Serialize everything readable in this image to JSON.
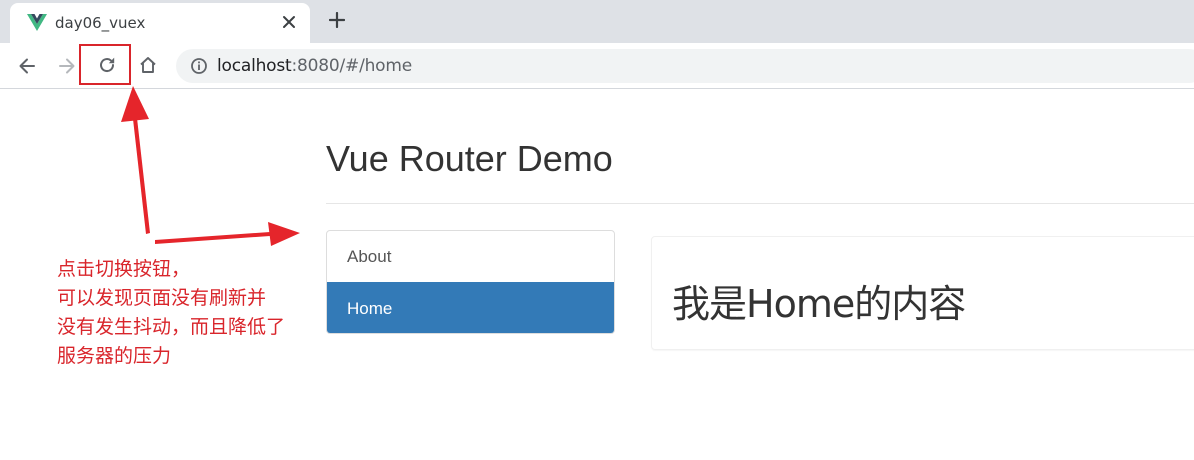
{
  "browser": {
    "tab_title": "day06_vuex",
    "url_host": "localhost",
    "url_rest": ":8080/#/home",
    "favicon": "vue-logo",
    "icons": [
      "back-icon",
      "forward-icon",
      "reload-icon",
      "home-icon",
      "info-icon",
      "close-icon",
      "plus-icon"
    ]
  },
  "page": {
    "title": "Vue Router Demo",
    "nav": [
      {
        "label": "About",
        "active": false
      },
      {
        "label": "Home",
        "active": true
      }
    ],
    "content": "我是Home的内容"
  },
  "annotation": {
    "lines": [
      "点击切换按钮，",
      "可以发现页面没有刷新并",
      "没有发生抖动，而且降低了",
      "服务器的压力"
    ],
    "color": "#d9252b"
  },
  "colors": {
    "accent": "#337ab7",
    "annotation": "#d9252b",
    "vue_green": "#41b883",
    "vue_dark": "#35495e"
  }
}
